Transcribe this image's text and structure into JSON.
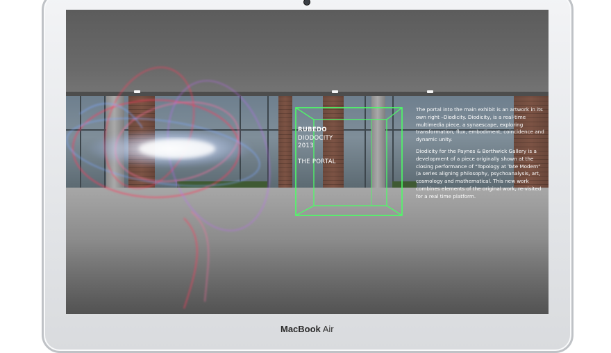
{
  "device": {
    "brand_main": "MacBook",
    "brand_model": "Air"
  },
  "scene": {
    "title_lines": [
      "RUBEDO",
      "DIODOCITY",
      "2013"
    ],
    "subtitle": "THE PORTAL",
    "description": [
      "The portal into the main exhibit is an artwork in its own right –Diodicity. Diodicity, is a real-time multimedia piece, a synaescape, exploring transformation, flux, embodiment, coincidence and dynamic unity.",
      "Diodicity for the Paynes & Borthwick Gallery is a development of a piece originally shown at the closing performance of “Topology at Tate Modern” (a series aligning philosophy, psychoanalysis, art, cosmology and mathematical. This new work combines elements of the original work, re-visited for a real time platform."
    ]
  },
  "colors": {
    "portal_outline": "#4dff66",
    "text": "#ffffff",
    "glow_red": "#ff3b5c",
    "glow_blue": "#7fa8ff"
  }
}
